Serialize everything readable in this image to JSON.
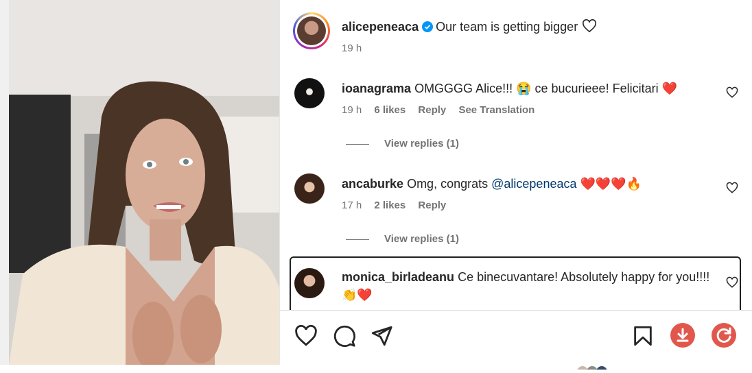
{
  "post": {
    "username": "alicepeneaca",
    "caption": "Our team is getting bigger",
    "time": "19 h"
  },
  "comments": [
    {
      "username": "ioanagrama",
      "text": "OMGGGG Alice!!! 😭 ce bucurieee! Felicitari ❤️",
      "time": "19 h",
      "likes": "6 likes",
      "reply": "Reply",
      "translation": "See Translation",
      "view_replies": "View replies (1)"
    },
    {
      "username": "ancaburke",
      "text_before": "Omg, congrats",
      "mention": "@alicepeneaca",
      "text_after": "❤️❤️❤️🔥",
      "time": "17 h",
      "likes": "2 likes",
      "reply": "Reply",
      "view_replies": "View replies (1)"
    },
    {
      "username": "monica_birladeanu",
      "text": "Ce binecuvantare! Absolutely happy for you!!!! 👏❤️"
    }
  ],
  "actions": {
    "like": "heart-icon",
    "comment": "comment-icon",
    "share": "share-icon",
    "save": "bookmark-icon",
    "download": "download-icon",
    "refresh": "refresh-icon"
  },
  "colors": {
    "accent_red": "#e2574c",
    "verified_blue": "#0095f6",
    "muted_text": "#737373"
  }
}
